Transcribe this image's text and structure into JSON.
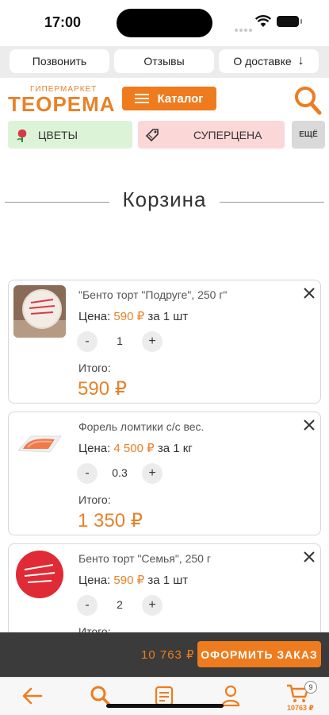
{
  "status_bar": {
    "time": "17:00"
  },
  "top_links": {
    "call": "Позвонить",
    "reviews": "Отзывы",
    "delivery": "О доставке",
    "delivery_arrow": "↓"
  },
  "header": {
    "logo_small": "ГИПЕРМАРКЕТ",
    "logo_big": "ТЕОРЕМА",
    "catalog_label": "Каталог"
  },
  "categories": {
    "flowers": "ЦВЕТЫ",
    "super_price": "СУПЕРЦЕНА",
    "more": "ЕЩЁ"
  },
  "page_title": "Корзина",
  "cart_items": [
    {
      "name": "\"Бенто торт \"Подруге\", 250 г\"",
      "price_label": "Цена:",
      "price": "590 ₽",
      "unit": "за 1 шт",
      "qty": "1",
      "total_label": "Итого:",
      "total": "590 ₽"
    },
    {
      "name": "Форель ломтики с/с вес.",
      "price_label": "Цена:",
      "price": "4 500 ₽",
      "unit": "за 1 кг",
      "qty": "0.3",
      "total_label": "Итого:",
      "total": "1 350 ₽"
    },
    {
      "name": "Бенто торт \"Семья\", 250 г",
      "price_label": "Цена:",
      "price": "590 ₽",
      "unit": "за 1 шт",
      "qty": "2",
      "total_label": "Итого:",
      "total": ""
    }
  ],
  "qty_minus": "-",
  "qty_plus": "+",
  "checkout": {
    "sum": "10 763 ₽",
    "button": "ОФОРМИТЬ ЗАКАЗ"
  },
  "bottom_nav": {
    "cart_sum": "10763 ₽",
    "cart_count": "9"
  },
  "colors": {
    "accent": "#ee7c1e",
    "green_tile": "#ddf3d8",
    "pink_tile": "#fbd7d8",
    "dark_bar": "#3b3b3b"
  }
}
